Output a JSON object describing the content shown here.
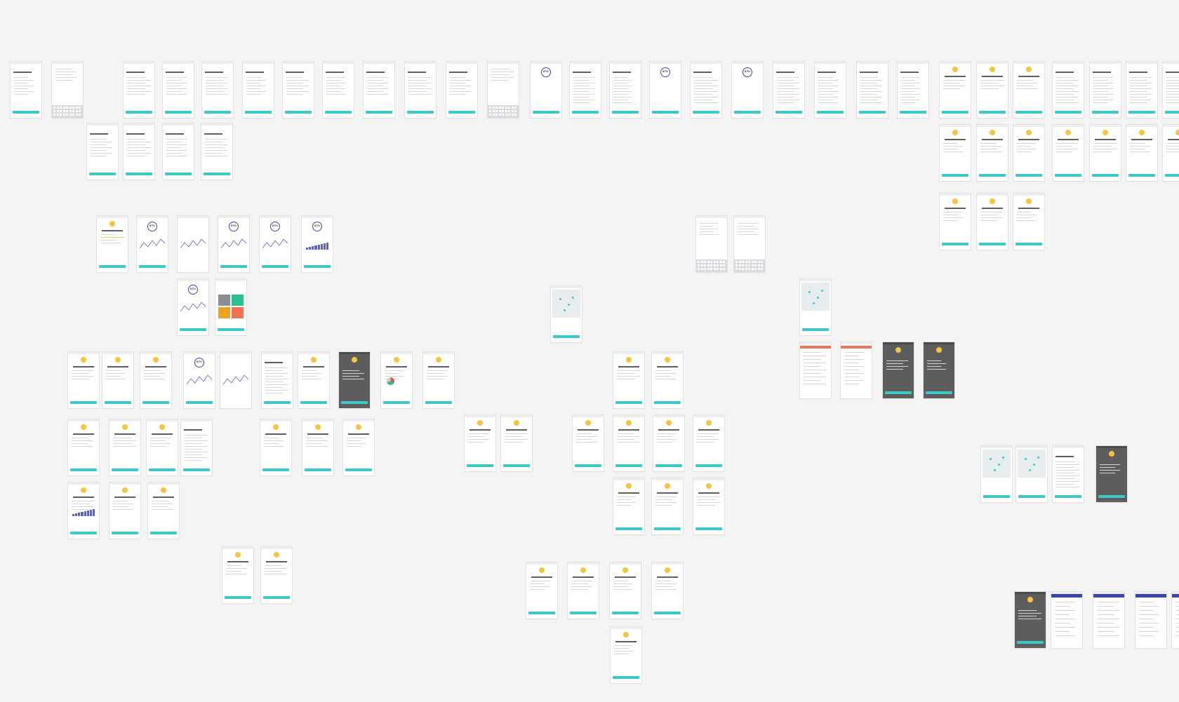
{
  "canvas": {
    "background": "#f4f4f4",
    "accent_teal": "#3cc7c9",
    "accent_indigo": "#3f47a8",
    "accent_yellow": "#f5c542",
    "accent_coral": "#f07358"
  },
  "frames": [
    {
      "type": "text"
    },
    {
      "type": "keyboard"
    },
    {
      "type": "text"
    },
    {
      "type": "text"
    },
    {
      "type": "text"
    },
    {
      "type": "text"
    },
    {
      "type": "text"
    },
    {
      "type": "text"
    },
    {
      "type": "text"
    },
    {
      "type": "text"
    },
    {
      "type": "text"
    },
    {
      "type": "keyboard"
    },
    {
      "type": "ring",
      "label": "87%"
    },
    {
      "type": "list"
    },
    {
      "type": "list"
    },
    {
      "type": "ring",
      "label": "87%"
    },
    {
      "type": "list"
    },
    {
      "type": "ring",
      "label": "87%"
    },
    {
      "type": "list"
    },
    {
      "type": "list"
    },
    {
      "type": "toggles"
    },
    {
      "type": "toggles"
    },
    {
      "type": "icon"
    },
    {
      "type": "icon"
    },
    {
      "type": "icon"
    },
    {
      "type": "onboard"
    },
    {
      "type": "onboard"
    },
    {
      "type": "onboard"
    },
    {
      "type": "onboard"
    },
    {
      "type": "text"
    },
    {
      "type": "text"
    },
    {
      "type": "text"
    },
    {
      "type": "text"
    },
    {
      "type": "icon"
    },
    {
      "type": "icon"
    },
    {
      "type": "icon"
    },
    {
      "type": "emoji"
    },
    {
      "type": "emoji"
    },
    {
      "type": "emoji"
    },
    {
      "type": "emoji"
    },
    {
      "type": "icon"
    },
    {
      "type": "icon"
    },
    {
      "type": "emoji"
    },
    {
      "type": "slider"
    },
    {
      "type": "ring-line",
      "label": "87%"
    },
    {
      "type": "line"
    },
    {
      "type": "ring-line",
      "label": "87%"
    },
    {
      "type": "ring-line",
      "label": "87%"
    },
    {
      "type": "ring-bars",
      "label": "87%"
    },
    {
      "type": "keyboard"
    },
    {
      "type": "keyboard"
    },
    {
      "type": "ring-line",
      "label": "87%"
    },
    {
      "type": "tiles"
    },
    {
      "type": "map"
    },
    {
      "type": "map"
    },
    {
      "type": "emoji"
    },
    {
      "type": "emoji"
    },
    {
      "type": "emoji"
    },
    {
      "type": "ring-line",
      "label": "87%"
    },
    {
      "type": "line"
    },
    {
      "type": "list"
    },
    {
      "type": "emoji"
    },
    {
      "type": "emoji-dark"
    },
    {
      "type": "emoji-pie"
    },
    {
      "type": "emoji"
    },
    {
      "type": "emoji"
    },
    {
      "type": "emoji"
    },
    {
      "type": "red"
    },
    {
      "type": "red"
    },
    {
      "type": "dark"
    },
    {
      "type": "dark"
    },
    {
      "type": "emoji"
    },
    {
      "type": "emoji"
    },
    {
      "type": "emoji"
    },
    {
      "type": "list"
    },
    {
      "type": "emoji"
    },
    {
      "type": "emoji"
    },
    {
      "type": "emoji"
    },
    {
      "type": "emoji"
    },
    {
      "type": "emoji"
    },
    {
      "type": "emoji"
    },
    {
      "type": "emoji"
    },
    {
      "type": "emoji"
    },
    {
      "type": "emoji"
    },
    {
      "type": "map"
    },
    {
      "type": "map"
    },
    {
      "type": "list"
    },
    {
      "type": "dark"
    },
    {
      "type": "emoji-bars"
    },
    {
      "type": "emoji"
    },
    {
      "type": "emoji"
    },
    {
      "type": "emoji"
    },
    {
      "type": "emoji"
    },
    {
      "type": "emoji"
    },
    {
      "type": "emoji"
    },
    {
      "type": "emoji"
    },
    {
      "type": "emoji"
    },
    {
      "type": "emoji"
    },
    {
      "type": "emoji"
    },
    {
      "type": "emoji"
    },
    {
      "type": "dark"
    },
    {
      "type": "navlist"
    },
    {
      "type": "navlist"
    },
    {
      "type": "navlist"
    },
    {
      "type": "navlist"
    },
    {
      "type": "emoji"
    }
  ]
}
